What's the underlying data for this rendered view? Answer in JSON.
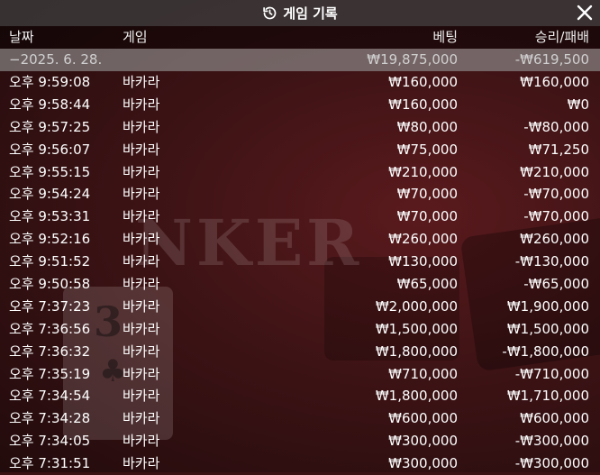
{
  "dialog": {
    "title": "게임 기록",
    "title_icon": "history-icon",
    "close_icon": "close-icon"
  },
  "background": {
    "watermark_text": "NKER",
    "card_value": "3",
    "card_suit": "♣"
  },
  "columns": {
    "date": "날짜",
    "game": "게임",
    "bet": "베팅",
    "result": "승리/패배"
  },
  "group": {
    "date": "−2025. 6. 28.",
    "bet_total": "₩19,875,000",
    "result_total": "-₩619,500"
  },
  "rows": [
    {
      "time": "오후 9:59:08",
      "game": "바카라",
      "bet": "₩160,000",
      "result": "₩160,000"
    },
    {
      "time": "오후 9:58:44",
      "game": "바카라",
      "bet": "₩160,000",
      "result": "₩0"
    },
    {
      "time": "오후 9:57:25",
      "game": "바카라",
      "bet": "₩80,000",
      "result": "-₩80,000"
    },
    {
      "time": "오후 9:56:07",
      "game": "바카라",
      "bet": "₩75,000",
      "result": "₩71,250"
    },
    {
      "time": "오후 9:55:15",
      "game": "바카라",
      "bet": "₩210,000",
      "result": "₩210,000"
    },
    {
      "time": "오후 9:54:24",
      "game": "바카라",
      "bet": "₩70,000",
      "result": "-₩70,000"
    },
    {
      "time": "오후 9:53:31",
      "game": "바카라",
      "bet": "₩70,000",
      "result": "-₩70,000"
    },
    {
      "time": "오후 9:52:16",
      "game": "바카라",
      "bet": "₩260,000",
      "result": "₩260,000"
    },
    {
      "time": "오후 9:51:52",
      "game": "바카라",
      "bet": "₩130,000",
      "result": "-₩130,000"
    },
    {
      "time": "오후 9:50:58",
      "game": "바카라",
      "bet": "₩65,000",
      "result": "-₩65,000"
    },
    {
      "time": "오후 7:37:23",
      "game": "바카라",
      "bet": "₩2,000,000",
      "result": "₩1,900,000"
    },
    {
      "time": "오후 7:36:56",
      "game": "바카라",
      "bet": "₩1,500,000",
      "result": "₩1,500,000"
    },
    {
      "time": "오후 7:36:32",
      "game": "바카라",
      "bet": "₩1,800,000",
      "result": "-₩1,800,000"
    },
    {
      "time": "오후 7:35:19",
      "game": "바카라",
      "bet": "₩710,000",
      "result": "-₩710,000"
    },
    {
      "time": "오후 7:34:54",
      "game": "바카라",
      "bet": "₩1,800,000",
      "result": "₩1,710,000"
    },
    {
      "time": "오후 7:34:28",
      "game": "바카라",
      "bet": "₩600,000",
      "result": "₩600,000"
    },
    {
      "time": "오후 7:34:05",
      "game": "바카라",
      "bet": "₩300,000",
      "result": "-₩300,000"
    },
    {
      "time": "오후 7:31:51",
      "game": "바카라",
      "bet": "₩300,000",
      "result": "-₩300,000"
    }
  ]
}
